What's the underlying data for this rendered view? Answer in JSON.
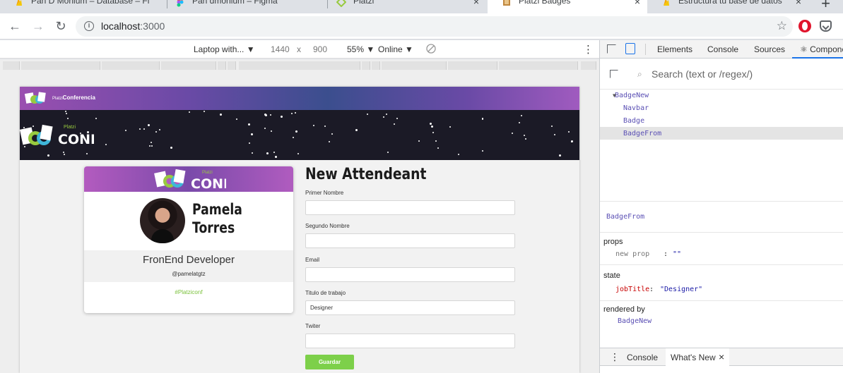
{
  "browser": {
    "tabs": [
      {
        "label": "Pan D Monium – Database – Fi"
      },
      {
        "label": "Pan dmonium – Figma"
      },
      {
        "label": "Platzi"
      },
      {
        "label": "Platzi Badges"
      },
      {
        "label": "Estructura tu base de datos"
      }
    ],
    "new_tab_symbol": "+",
    "close_symbol": "×",
    "url_host": "localhost",
    "url_port": ":3000",
    "back_symbol": "←",
    "forward_symbol": "→",
    "reload_symbol": "↻",
    "info_symbol": "i",
    "star_symbol": "☆"
  },
  "device_toolbar": {
    "device": "Laptop with... ▼",
    "width": "1440",
    "times": "x",
    "height": "900",
    "zoom": "55% ▼",
    "network": "Online ▼",
    "menu": "⋮"
  },
  "app": {
    "navbar": {
      "brand_prefix": "Platzi",
      "brand": "Conferencia"
    },
    "badge": {
      "first_name": "Pamela",
      "last_name": "Torres",
      "job_title": "FronEnd Developer",
      "handle": "@pamelatgtz",
      "hashtag": "#Platziconf"
    },
    "form": {
      "title": "New Attendeant",
      "fields": [
        {
          "label": "Primer Nombre",
          "value": ""
        },
        {
          "label": "Segundo Nombre",
          "value": ""
        },
        {
          "label": "Email",
          "value": ""
        },
        {
          "label": "Titulo de trabajo",
          "value": "Designer"
        },
        {
          "label": "Twiter",
          "value": ""
        }
      ],
      "submit_label": "Guardar"
    },
    "logo_text": {
      "platzi": "Platzi",
      "conf": "CONF"
    }
  },
  "devtools": {
    "tabs": [
      "Elements",
      "Console",
      "Sources",
      "⚛ Compone"
    ],
    "search_placeholder": "Search (text or /regex/)",
    "search_icon": "⌕",
    "tree": [
      {
        "label": "BadgeNew",
        "expanded": true
      },
      {
        "label": "Navbar"
      },
      {
        "label": "Badge"
      },
      {
        "label": "BadgeFrom",
        "selected": true
      }
    ],
    "tree_arrow": "▼",
    "selected_component": "BadgeFrom",
    "props_heading": "props",
    "props_key": "new prop",
    "props_sep": ":",
    "props_value": "\"\"",
    "state_heading": "state",
    "state_key": "jobTitle",
    "state_colon": ":",
    "state_value": "\"Designer\"",
    "rendered_heading": "rendered by",
    "rendered_by": "BadgeNew",
    "drawer": {
      "menu": "⋮",
      "tabs": [
        "Console",
        "What's New"
      ],
      "close": "×"
    }
  },
  "colors": {
    "accent_blue": "#1a73e8",
    "brand_purple": "#9a4fb0",
    "save_green": "#7dd04a",
    "hashtag_green": "#7ac13a",
    "react_key": "#c80000",
    "react_string": "#1a1aa6"
  }
}
